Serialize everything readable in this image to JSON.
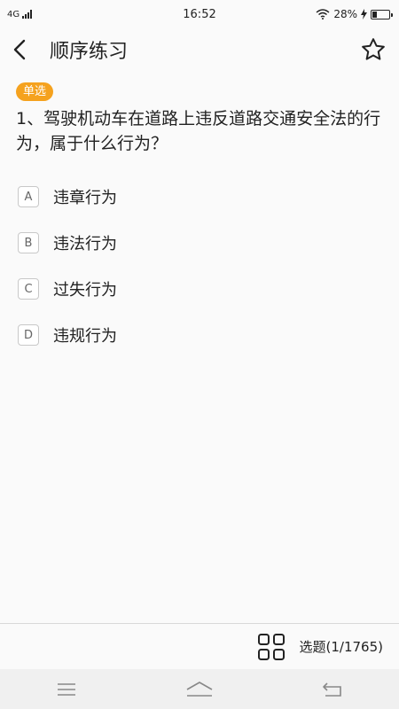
{
  "status_bar": {
    "network": "4G",
    "time": "16:52",
    "battery_percent": "28%",
    "battery_level": 0.28,
    "icons": [
      "signal-icon",
      "wifi-icon",
      "charging-icon",
      "battery-icon"
    ]
  },
  "header": {
    "title": "顺序练习",
    "back_icon": "chevron-left-icon",
    "favorite_icon": "star-outline-icon"
  },
  "question": {
    "type_badge": "单选",
    "text": "1、驾驶机动车在道路上违反道路交通安全法的行为，属于什么行为？",
    "options": [
      {
        "key": "A",
        "text": "违章行为"
      },
      {
        "key": "B",
        "text": "违法行为"
      },
      {
        "key": "C",
        "text": "过失行为"
      },
      {
        "key": "D",
        "text": "违规行为"
      }
    ]
  },
  "toolbar": {
    "grid_icon": "grid-icon",
    "select_label": "选题(1/1765)"
  },
  "nav_bar": {
    "icons": [
      "menu-icon",
      "home-icon",
      "back-arrow-icon"
    ]
  },
  "colors": {
    "badge": "#f5a21e",
    "background": "#fafafa",
    "text": "#222222"
  }
}
